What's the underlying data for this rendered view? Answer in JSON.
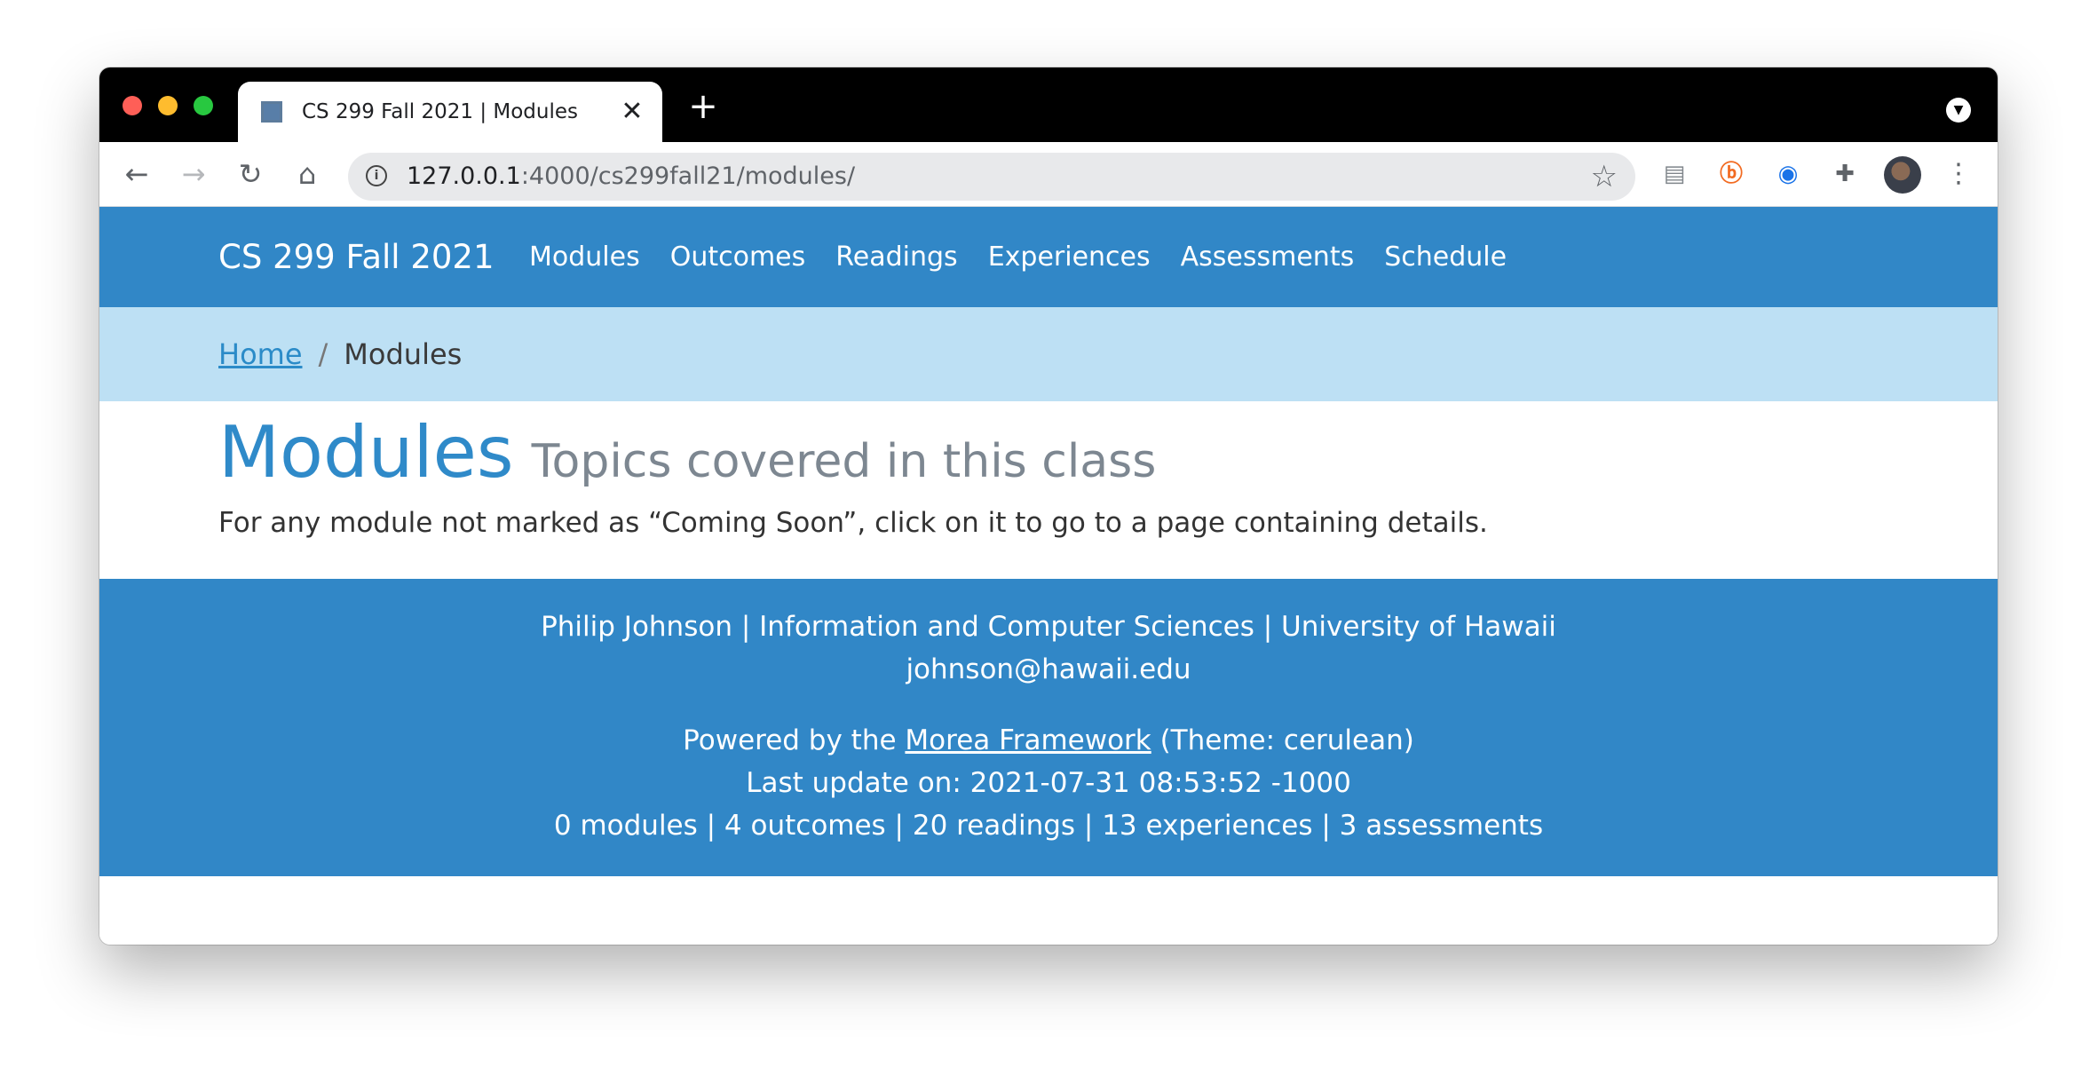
{
  "browser": {
    "tab": {
      "title": "CS 299 Fall 2021 | Modules"
    },
    "new_tab": "+",
    "url": {
      "host": "127.0.0.1",
      "path": ":4000/cs299fall21/modules/"
    }
  },
  "site": {
    "brand": "CS 299 Fall 2021",
    "nav": [
      "Modules",
      "Outcomes",
      "Readings",
      "Experiences",
      "Assessments",
      "Schedule"
    ],
    "breadcrumb": {
      "home": "Home",
      "separator": "/",
      "current": "Modules"
    },
    "heading": {
      "title": "Modules",
      "subtitle": "Topics covered in this class"
    },
    "intro": "For any module not marked as “Coming Soon”, click on it to go to a page containing details.",
    "footer": {
      "line1": "Philip Johnson | Information and Computer Sciences | University of Hawaii",
      "email": "johnson@hawaii.edu",
      "powered_prefix": "Powered by the ",
      "powered_link": "Morea Framework",
      "powered_suffix": " (Theme: cerulean)",
      "last_update": "Last update on: 2021-07-31 08:53:52 -1000",
      "counts": "0 modules | 4 outcomes | 20 readings | 13 experiences | 3 assessments"
    }
  },
  "colors": {
    "navbar": "#3187c7",
    "breadcrumb_bg": "#bde0f4",
    "heading": "#2f8ac9",
    "subtitle": "#7d8791"
  },
  "icons": [
    "back-icon",
    "forward-icon",
    "reload-icon",
    "home-icon",
    "info-icon",
    "star-icon",
    "page-icon",
    "extension-b-icon",
    "extension-lock-icon",
    "puzzle-icon",
    "menu-icon"
  ]
}
